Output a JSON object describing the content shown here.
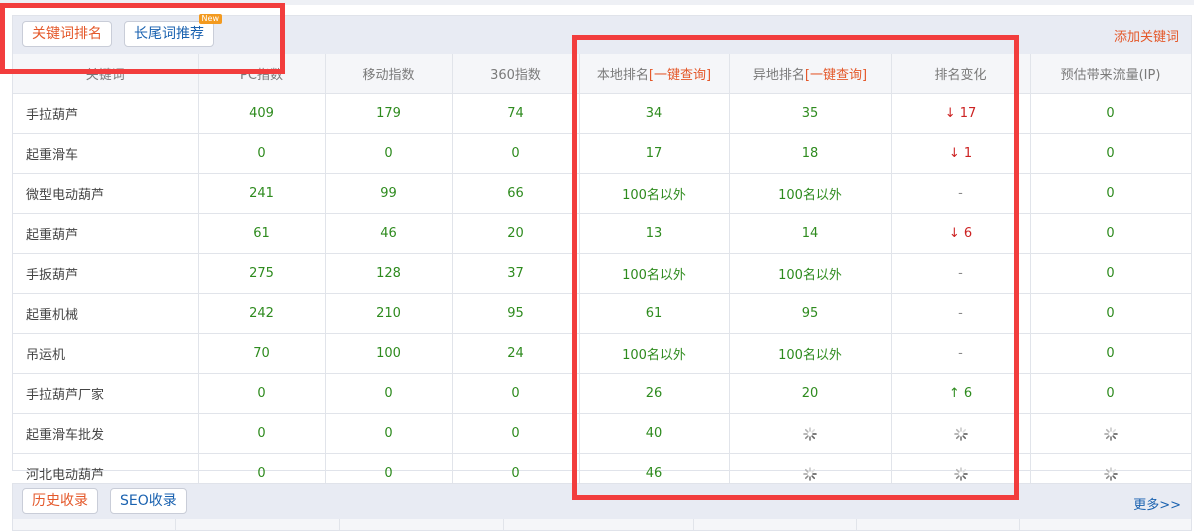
{
  "tabs": {
    "keyword_rank": "关键词排名",
    "longtail": "长尾词推荐",
    "new_badge": "New",
    "add_keyword": "添加关键词"
  },
  "columns": {
    "keyword": "关键词",
    "pc_index": "PC指数",
    "mobile_index": "移动指数",
    "index_360": "360指数",
    "local_rank": "本地排名",
    "remote_rank": "异地排名",
    "one_click_query": "[一键查询]",
    "rank_change": "排名变化",
    "traffic": "预估带来流量(IP)"
  },
  "colors": {
    "accent": "#e4582a",
    "link": "#1a62b0",
    "value": "#2e8b1e",
    "down": "#cc2222",
    "highlight_box": "#f23d3d"
  },
  "rows": [
    {
      "keyword": "手拉葫芦",
      "pc": "409",
      "mobile": "179",
      "i360": "74",
      "local": "34",
      "remote": "35",
      "change": {
        "dir": "down",
        "text": "17"
      },
      "traffic": "0"
    },
    {
      "keyword": "起重滑车",
      "pc": "0",
      "mobile": "0",
      "i360": "0",
      "local": "17",
      "remote": "18",
      "change": {
        "dir": "down",
        "text": "1"
      },
      "traffic": "0"
    },
    {
      "keyword": "微型电动葫芦",
      "pc": "241",
      "mobile": "99",
      "i360": "66",
      "local": "100名以外",
      "remote": "100名以外",
      "change": {
        "dir": "none",
        "text": "-"
      },
      "traffic": "0"
    },
    {
      "keyword": "起重葫芦",
      "pc": "61",
      "mobile": "46",
      "i360": "20",
      "local": "13",
      "remote": "14",
      "change": {
        "dir": "down",
        "text": "6"
      },
      "traffic": "0"
    },
    {
      "keyword": "手扳葫芦",
      "pc": "275",
      "mobile": "128",
      "i360": "37",
      "local": "100名以外",
      "remote": "100名以外",
      "change": {
        "dir": "none",
        "text": "-"
      },
      "traffic": "0"
    },
    {
      "keyword": "起重机械",
      "pc": "242",
      "mobile": "210",
      "i360": "95",
      "local": "61",
      "remote": "95",
      "change": {
        "dir": "none",
        "text": "-"
      },
      "traffic": "0"
    },
    {
      "keyword": "吊运机",
      "pc": "70",
      "mobile": "100",
      "i360": "24",
      "local": "100名以外",
      "remote": "100名以外",
      "change": {
        "dir": "none",
        "text": "-"
      },
      "traffic": "0"
    },
    {
      "keyword": "手拉葫芦厂家",
      "pc": "0",
      "mobile": "0",
      "i360": "0",
      "local": "26",
      "remote": "20",
      "change": {
        "dir": "up",
        "text": "6"
      },
      "traffic": "0"
    },
    {
      "keyword": "起重滑车批发",
      "pc": "0",
      "mobile": "0",
      "i360": "0",
      "local": "40",
      "remote": "loading",
      "change": {
        "dir": "loading",
        "text": ""
      },
      "traffic": "loading"
    },
    {
      "keyword": "河北电动葫芦",
      "pc": "0",
      "mobile": "0",
      "i360": "0",
      "local": "46",
      "remote": "loading",
      "change": {
        "dir": "loading",
        "text": ""
      },
      "traffic": "loading"
    }
  ],
  "bottom": {
    "history": "历史收录",
    "seo": "SEO收录",
    "more": "更多>>"
  }
}
